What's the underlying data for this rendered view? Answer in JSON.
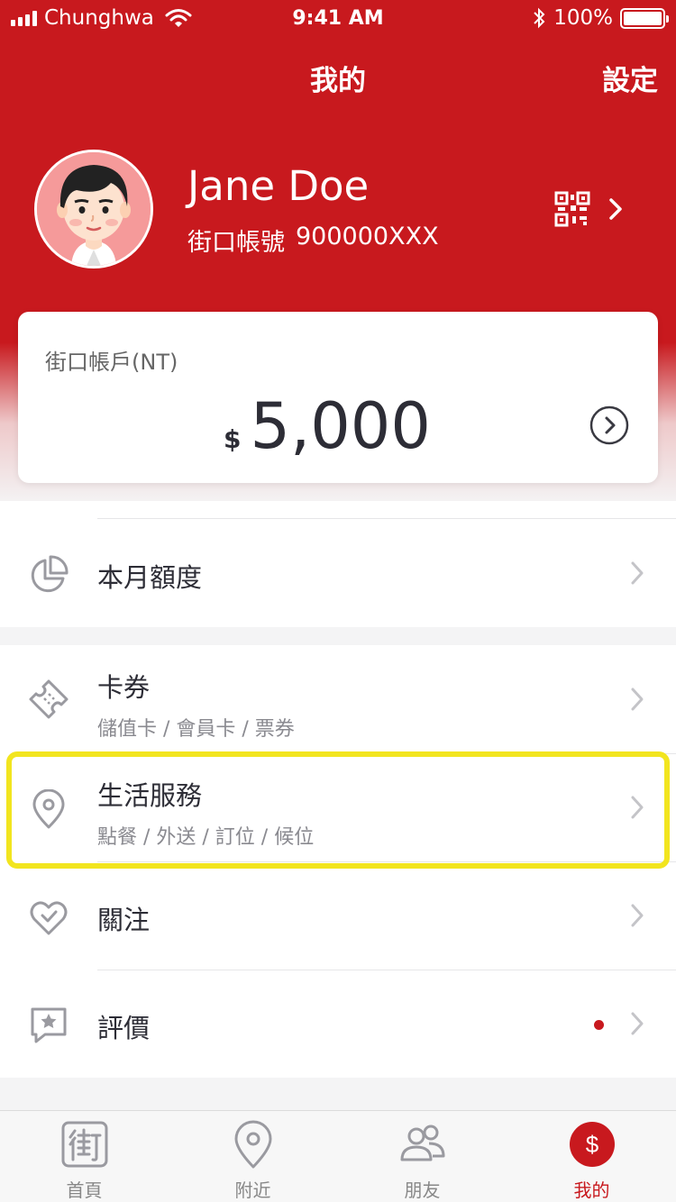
{
  "status_bar": {
    "carrier": "Chunghwa",
    "time": "9:41 AM",
    "battery": "100%"
  },
  "nav": {
    "title": "我的",
    "settings": "設定"
  },
  "profile": {
    "name": "Jane Doe",
    "account_label": "街口帳號",
    "account_number": "900000XXX"
  },
  "balance": {
    "label": "街口帳戶(NT)",
    "currency": "$",
    "amount": "5,000"
  },
  "menu": {
    "monthly_limit": {
      "title": "本月額度"
    },
    "coupons": {
      "title": "卡券",
      "subtitle": "儲值卡 / 會員卡 / 票券"
    },
    "life_services": {
      "title": "生活服務",
      "subtitle": "點餐 / 外送 / 訂位 / 候位"
    },
    "follow": {
      "title": "關注"
    },
    "reviews": {
      "title": "評價",
      "has_notification": true
    }
  },
  "tabs": [
    {
      "label": "首頁",
      "icon": "home-street-icon",
      "active": false
    },
    {
      "label": "附近",
      "icon": "location-pin-icon",
      "active": false
    },
    {
      "label": "朋友",
      "icon": "friends-icon",
      "active": false
    },
    {
      "label": "我的",
      "icon": "dollar-icon",
      "active": true
    }
  ],
  "colors": {
    "brand_red": "#c8191e",
    "highlight": "#f2e51f"
  }
}
